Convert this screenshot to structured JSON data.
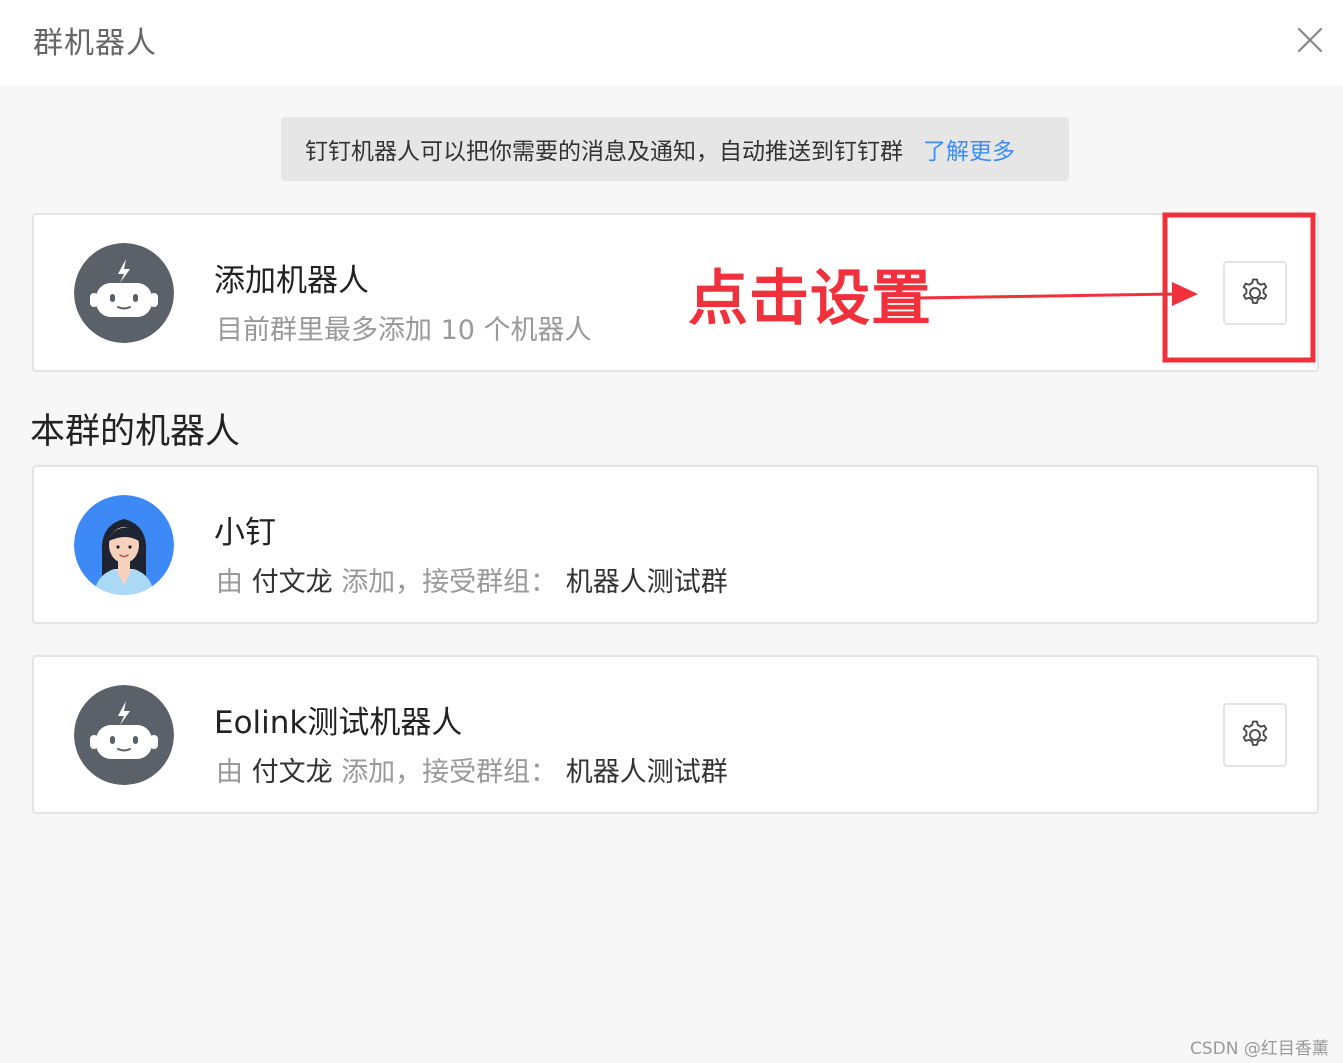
{
  "dialog": {
    "title": "群机器人"
  },
  "notice": {
    "text": "钉钉机器人可以把你需要的消息及通知，自动推送到钉钉群",
    "link": "了解更多"
  },
  "add_robot": {
    "title": "添加机器人",
    "subtitle": "目前群里最多添加 10 个机器人",
    "icon": "robot-icon"
  },
  "section": {
    "title": "本群的机器人"
  },
  "robots": [
    {
      "name": "小钉",
      "prefix": "由",
      "adder": "付文龙",
      "middle": "添加，接受群组：",
      "group": "机器人测试群",
      "avatar": "person-avatar"
    },
    {
      "name": "Eolink测试机器人",
      "prefix": "由",
      "adder": "付文龙",
      "middle": "添加，接受群组：",
      "group": "机器人测试群",
      "avatar": "robot-icon"
    }
  ],
  "annotation": {
    "text": "点击设置",
    "color": "#f0313c"
  },
  "watermark": "CSDN @红目香薰",
  "colors": {
    "link": "#3a8ef6",
    "robot_avatar": "#5b6169",
    "annotation": "#f0313c"
  }
}
